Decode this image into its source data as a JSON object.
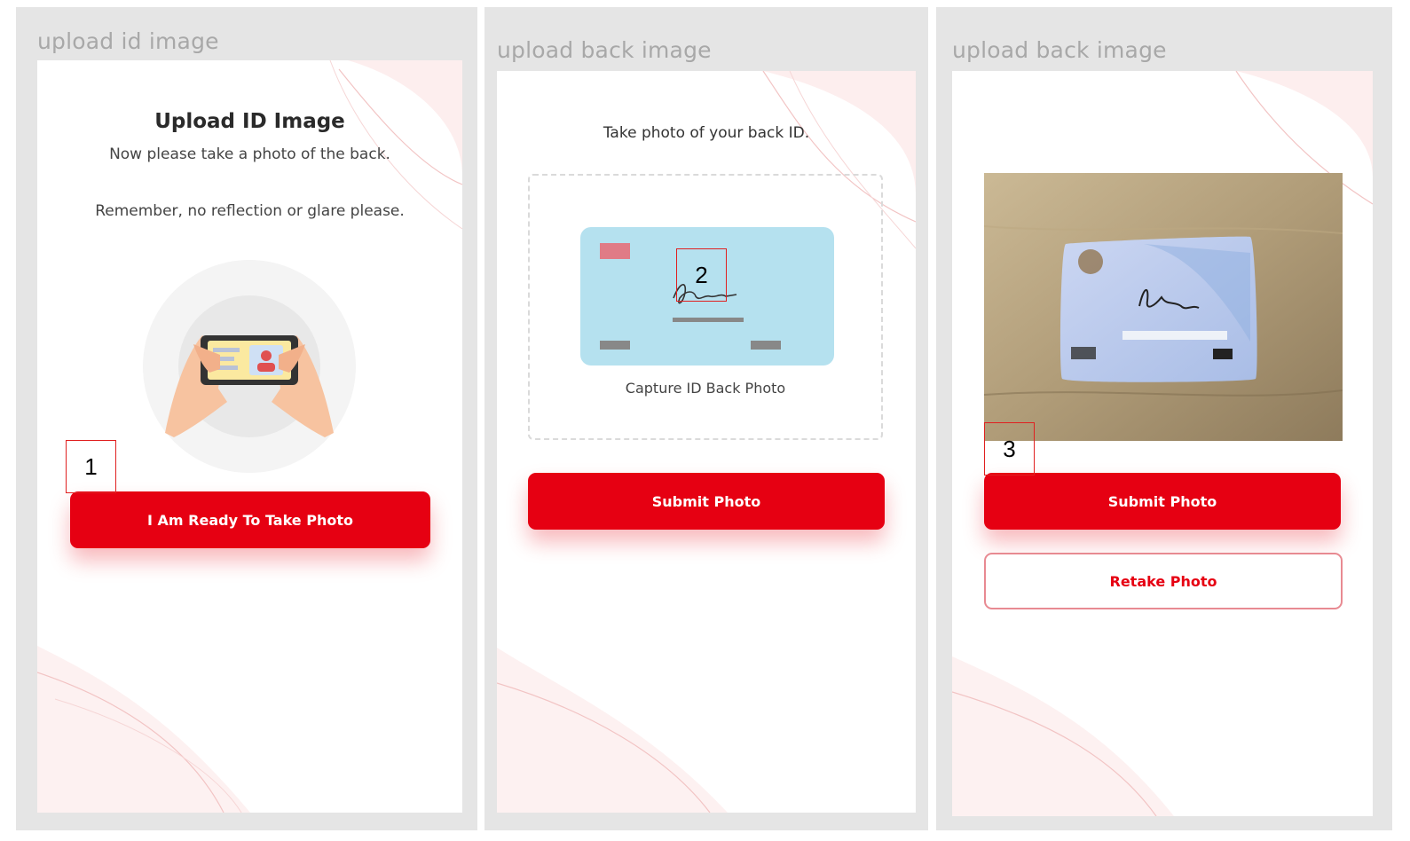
{
  "panel1": {
    "title": "upload id image",
    "heading": "Upload ID Image",
    "subtitle": "Now please take a photo of the back.",
    "note": "Remember, no reflection or glare please.",
    "illustration_icon": "hands-holding-phone-icon",
    "button_label": "I Am Ready To Take Photo",
    "annotation": "1"
  },
  "panel2": {
    "title": "upload back image",
    "instruction": "Take photo of your back ID.",
    "card_icon": "id-card-back-icon",
    "capture_label": "Capture ID Back Photo",
    "button_label": "Submit Photo",
    "annotation": "2"
  },
  "panel3": {
    "title": "upload back image",
    "photo_icon": "captured-id-photo",
    "submit_label": "Submit Photo",
    "retake_label": "Retake Photo",
    "annotation": "3"
  },
  "colors": {
    "accent": "#e60012",
    "panel_bg": "#e5e5e5",
    "title_gray": "#a8a8a8",
    "annotation_border": "#e02020"
  }
}
